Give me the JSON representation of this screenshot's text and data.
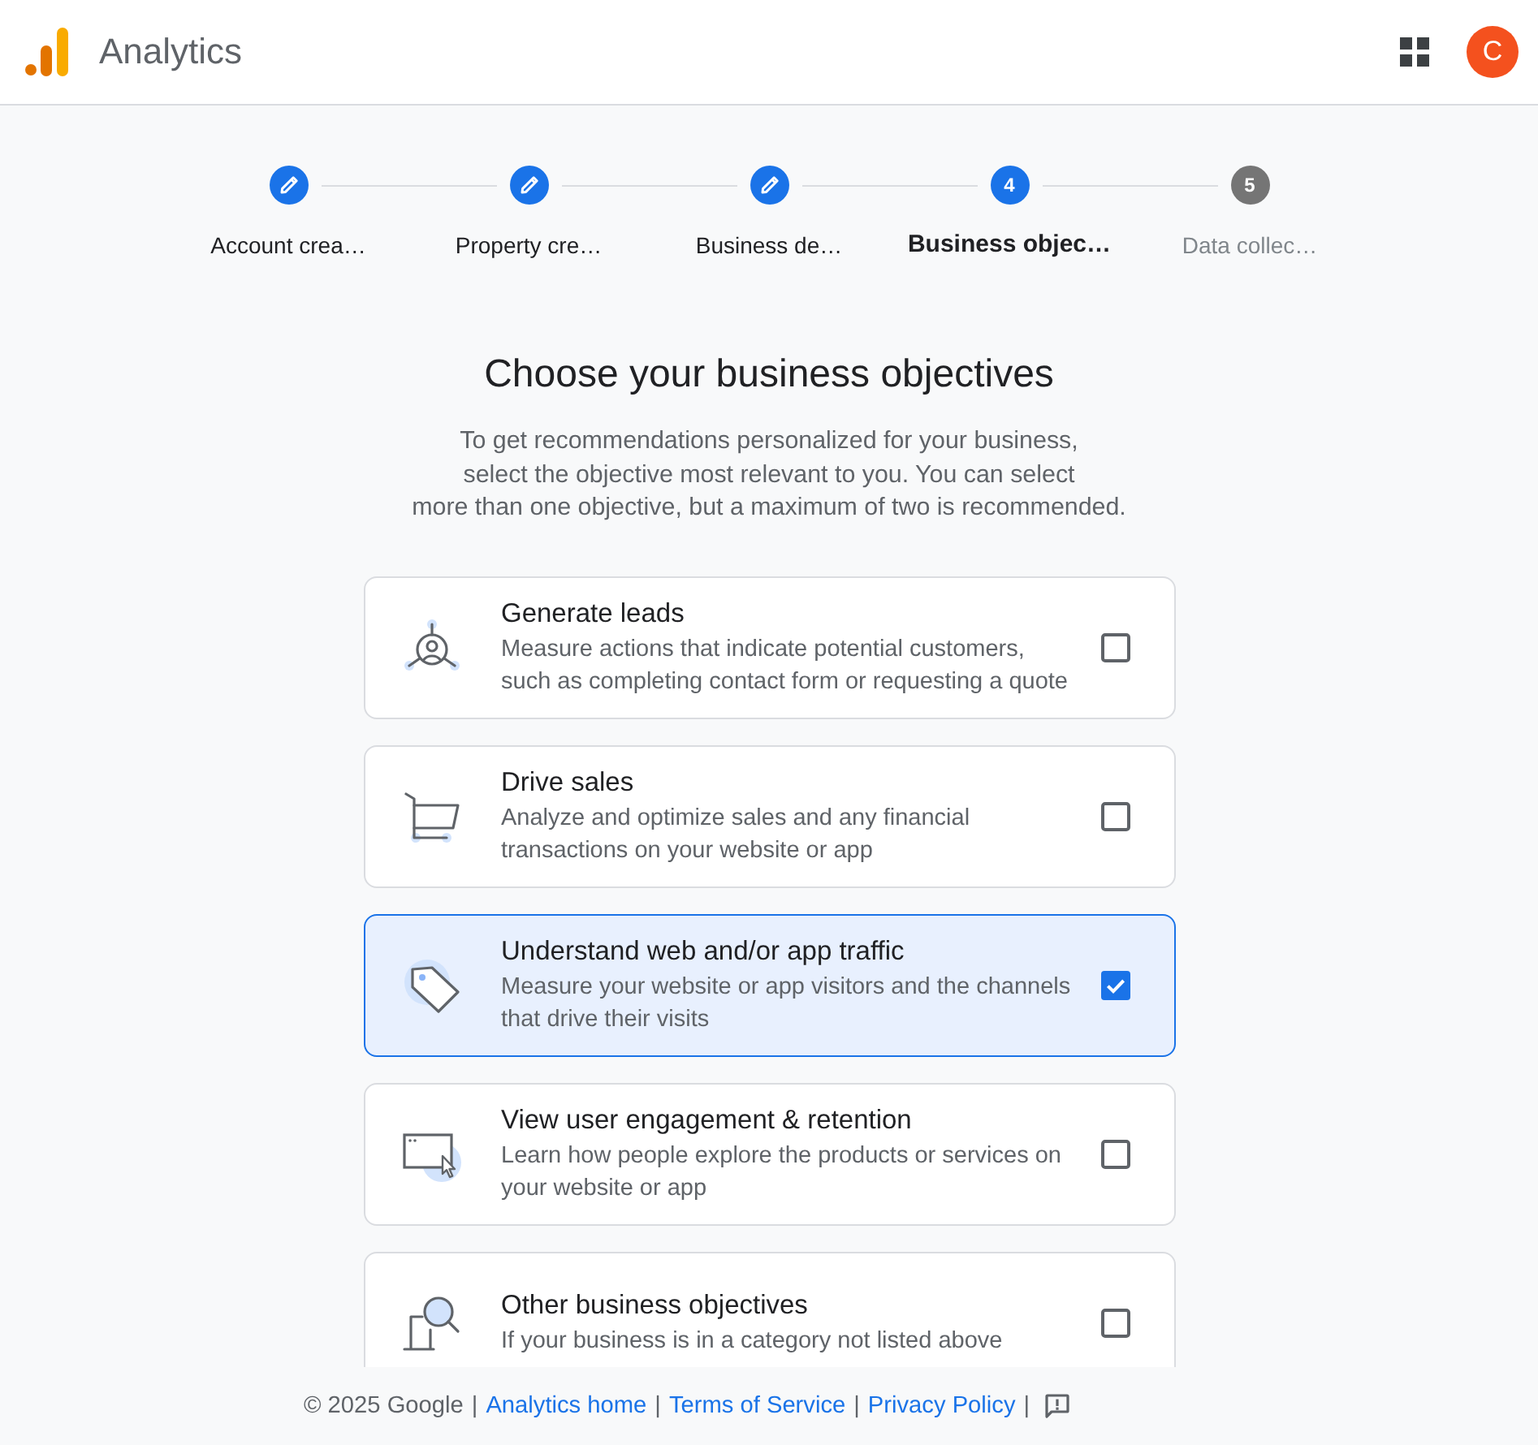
{
  "header": {
    "app_title": "Analytics",
    "avatar_initial": "C"
  },
  "steps": [
    {
      "label": "Account crea…",
      "completed": true,
      "selected": false
    },
    {
      "label": "Property cre…",
      "completed": true,
      "selected": false
    },
    {
      "label": "Business de…",
      "completed": true,
      "selected": false
    },
    {
      "number": "4",
      "label": "Business objec…",
      "completed": false,
      "selected": true
    },
    {
      "number": "5",
      "label": "Data collec…",
      "completed": false,
      "selected": false
    }
  ],
  "heading": "Choose your business objectives",
  "description_lines": [
    "To get recommendations personalized for your business,",
    "select the objective most relevant to you. You can select",
    "more than one objective, but a maximum of two is recommended."
  ],
  "objectives": [
    {
      "kind": "leads",
      "title": "Generate leads",
      "description": "Measure actions that indicate potential customers, such as completing contact form or requesting a quote",
      "checked": false
    },
    {
      "kind": "sales",
      "title": "Drive sales",
      "description": "Analyze and optimize sales and any financial transactions on your website or app",
      "checked": false
    },
    {
      "kind": "traffic",
      "title": "Understand web and/or app traffic",
      "description": "Measure your website or app visitors and the channels that drive their visits",
      "checked": true
    },
    {
      "kind": "engagement",
      "title": "View user engagement & retention",
      "description": "Learn how people explore the products or services on your website or app",
      "checked": false
    },
    {
      "kind": "other",
      "title": "Other business objectives",
      "description": "If your business is in a category not listed above",
      "checked": false
    }
  ],
  "footer": {
    "items": [
      {
        "kind": "text",
        "text": "© 2025 Google"
      },
      {
        "kind": "separator",
        "text": "|"
      },
      {
        "kind": "link",
        "text": "Analytics home"
      },
      {
        "kind": "separator",
        "text": "|"
      },
      {
        "kind": "link",
        "text": "Terms of Service"
      },
      {
        "kind": "separator",
        "text": "|"
      },
      {
        "kind": "link",
        "text": "Privacy Policy"
      },
      {
        "kind": "separator",
        "text": "|"
      },
      {
        "kind": "feedback"
      }
    ]
  }
}
